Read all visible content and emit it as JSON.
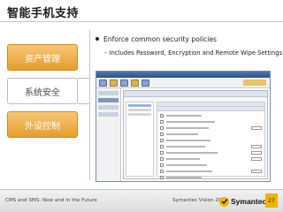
{
  "slide": {
    "title": "智能手机支持",
    "nav": [
      {
        "label": "资产管理",
        "active": false
      },
      {
        "label": "系统安全",
        "active": true
      },
      {
        "label": "外设控制",
        "active": false
      }
    ],
    "bullet": "Enforce common security policies",
    "sub_bullet": "– Includes Password, Encryption and Remote Wipe Settings",
    "screenshot_icon": "console-screenshot"
  },
  "footer": {
    "left_text": "CMS and SMS: Now and in the Future",
    "center_text": "Symantec Vision 2010",
    "logo_text": "Symantec.",
    "page_number": "27",
    "accent_color": "#f0b400"
  },
  "colors": {
    "nav_inactive": "#e59d2d",
    "nav_active_bg": "#ffffff"
  }
}
